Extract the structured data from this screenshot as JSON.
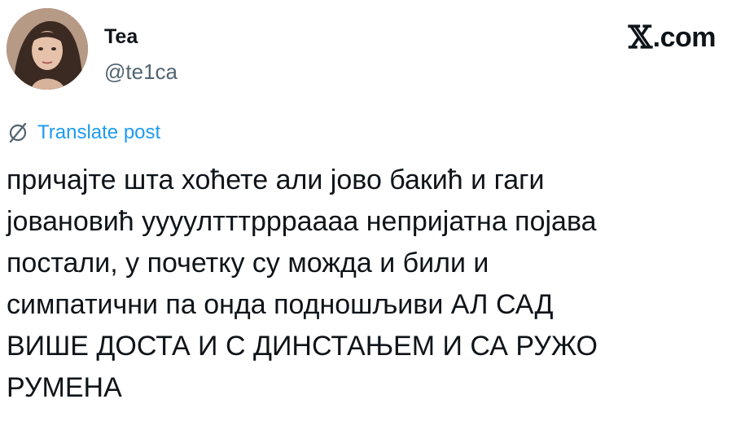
{
  "author": {
    "name": "Tea",
    "handle": "@te1ca",
    "avatar_icon": "profile-photo"
  },
  "brand": {
    "logo_glyph": "𝕏",
    "logo_text": ".com"
  },
  "translate": {
    "icon": "globe-slash-icon",
    "label": "Translate post",
    "color": "#1d9bf0"
  },
  "post": {
    "text": "причајте шта хоћете али јово бакић и гаги\nјовановић уууултттрррaааа непријатна појава\nпостали, у почетку су можда и били и\nсимпатични па онда подношљиви АЛ САД\nВИШЕ ДОСТА И С ДИНСТАЊЕМ И СА РУЖО\nРУМЕНА"
  }
}
